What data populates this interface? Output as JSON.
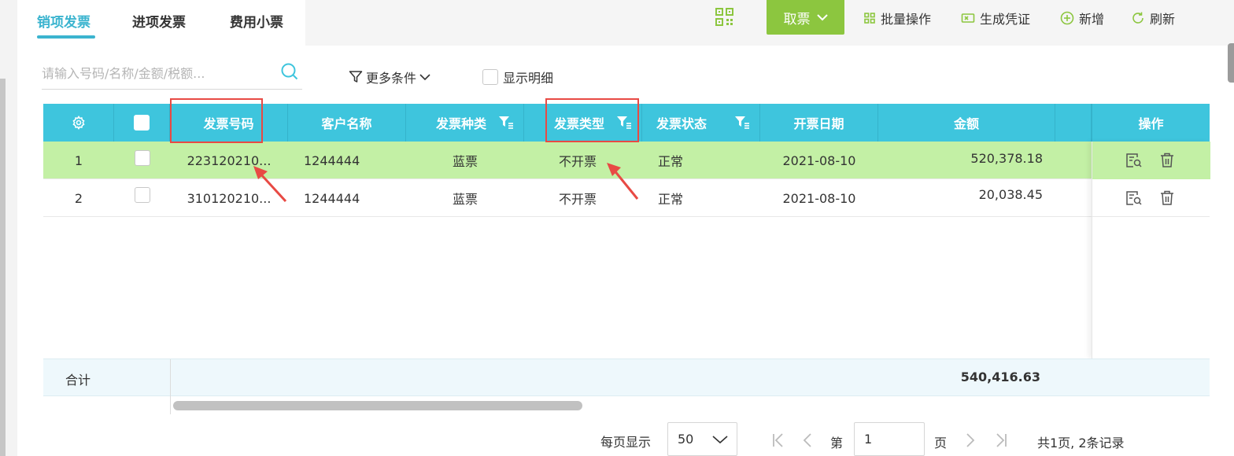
{
  "tabs": [
    {
      "label": "销项发票",
      "active": true
    },
    {
      "label": "进项发票",
      "active": false
    },
    {
      "label": "费用小票",
      "active": false
    }
  ],
  "toolbar": {
    "fetch_label": "取票",
    "batch_label": "批量操作",
    "voucher_label": "生成凭证",
    "add_label": "新增",
    "refresh_label": "刷新"
  },
  "search": {
    "placeholder": "请输入号码/名称/金额/税额..."
  },
  "filters": {
    "more_label": "更多条件",
    "show_detail_label": "显示明细"
  },
  "table": {
    "headers": [
      "发票号码",
      "客户名称",
      "发票种类",
      "发票类型",
      "发票状态",
      "开票日期",
      "金额",
      "操作"
    ],
    "rows": [
      {
        "index": "1",
        "number": "223120210...",
        "customer": "1244444",
        "kind": "蓝票",
        "type": "不开票",
        "status": "正常",
        "date": "2021-08-10",
        "amount": "520,378.18",
        "highlighted": true
      },
      {
        "index": "2",
        "number": "310120210...",
        "customer": "1244444",
        "kind": "蓝票",
        "type": "不开票",
        "status": "正常",
        "date": "2021-08-10",
        "amount": "20,038.45",
        "highlighted": false
      }
    ],
    "footer": {
      "label": "合计",
      "total": "540,416.63"
    }
  },
  "pagination": {
    "per_page_label": "每页显示",
    "per_page": "50",
    "page_prefix": "第",
    "page": "1",
    "page_suffix": "页",
    "summary": "共1页, 2条记录"
  },
  "colors": {
    "accent": "#3ec5dd",
    "green_button": "#8cc63f",
    "highlight_row": "#c3f0a5",
    "annotation_red": "#e84a44",
    "tab_active": "#3bb4cf"
  }
}
